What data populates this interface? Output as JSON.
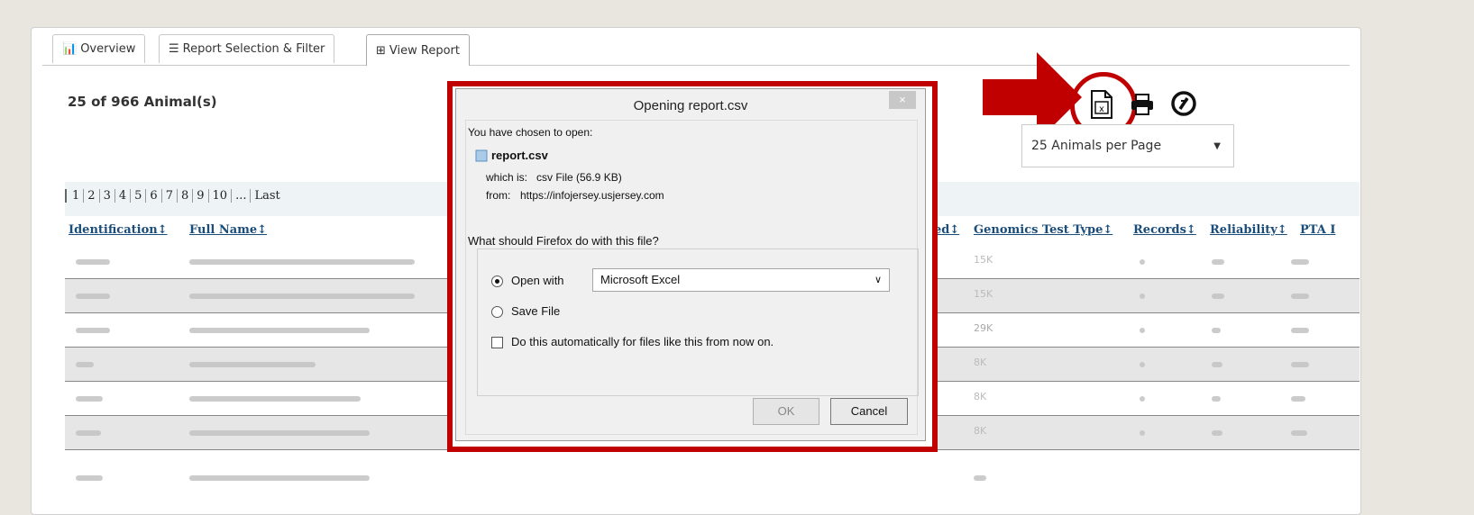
{
  "tabs": [
    {
      "label": "Overview",
      "icon": "chart-icon"
    },
    {
      "label": "Report Selection & Filter",
      "icon": "list-icon"
    },
    {
      "label": "View Report",
      "icon": "table-icon"
    }
  ],
  "count_title": "25 of 966 Animal(s)",
  "per_page": "25 Animals per Page",
  "pager": [
    "1",
    "2",
    "3",
    "4",
    "5",
    "6",
    "7",
    "8",
    "9",
    "10",
    "...",
    "Last"
  ],
  "headers": {
    "identification": "Identification↕",
    "full_name": "Full Name↕",
    "ed": "ed↕",
    "genomics": "Genomics Test Type↕",
    "records": "Records↕",
    "reliability": "Reliability↕",
    "pta": "PTA I"
  },
  "rows_visible": [
    "15K",
    "15K",
    "29K",
    "8K",
    "8K",
    "8K"
  ],
  "dialog": {
    "title": "Opening report.csv",
    "close": "×",
    "chosen": "You have chosen to open:",
    "filename": "report.csv",
    "which_is_label": "which is:",
    "which_is": "csv File (56.9 KB)",
    "from_label": "from:",
    "from": "https://infojersey.usjersey.com",
    "question": "What should Firefox do with this file?",
    "open_with_label": "Open with",
    "open_with_app": "Microsoft Excel",
    "save_label": "Save File",
    "auto_label": "Do this automatically for files like this from now on.",
    "ok": "OK",
    "cancel": "Cancel"
  },
  "colors": {
    "highlight": "#c00000",
    "header_link": "#1a4d7a"
  }
}
